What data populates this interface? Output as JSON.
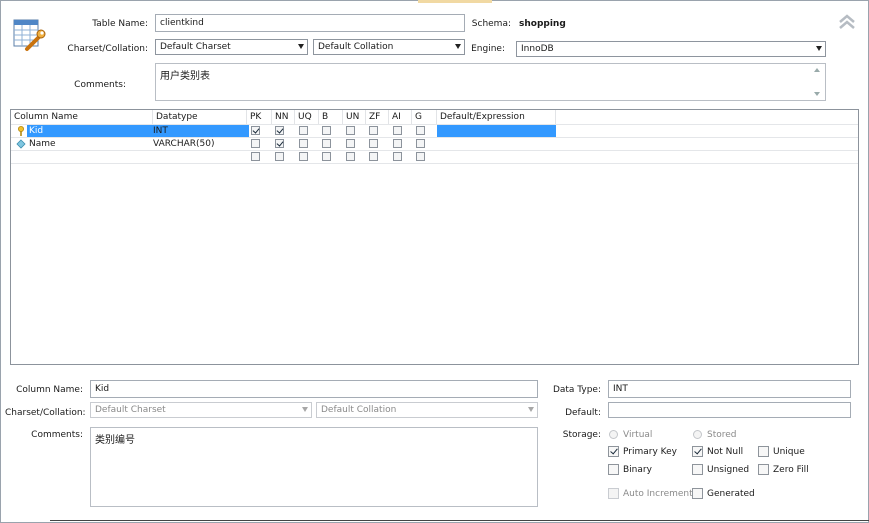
{
  "table": {
    "name_label": "Table Name:",
    "name_value": "clientkind",
    "schema_label": "Schema:",
    "schema_value": "shopping",
    "charset_label": "Charset/Collation:",
    "charset_value": "Default Charset",
    "collation_value": "Default Collation",
    "engine_label": "Engine:",
    "engine_value": "InnoDB",
    "comments_label": "Comments:",
    "comments_value": "用户类别表"
  },
  "grid": {
    "headers": [
      "Column Name",
      "Datatype",
      "PK",
      "NN",
      "UQ",
      "B",
      "UN",
      "ZF",
      "AI",
      "G",
      "Default/Expression"
    ],
    "rows": [
      {
        "name": "Kid",
        "datatype": "INT",
        "flags": [
          true,
          true,
          false,
          false,
          false,
          false,
          false,
          false
        ],
        "default": ""
      },
      {
        "name": "Name",
        "datatype": "VARCHAR(50)",
        "flags": [
          false,
          true,
          false,
          false,
          false,
          false,
          false,
          false
        ],
        "default": ""
      },
      {
        "name": "",
        "datatype": "",
        "flags": [
          false,
          false,
          false,
          false,
          false,
          false,
          false,
          false
        ],
        "default": ""
      }
    ]
  },
  "column": {
    "name_label": "Column Name:",
    "name_value": "Kid",
    "datatype_label": "Data Type:",
    "datatype_value": "INT",
    "charset_label": "Charset/Collation:",
    "charset_value": "Default Charset",
    "collation_value": "Default Collation",
    "default_label": "Default:",
    "default_value": "",
    "comments_label": "Comments:",
    "comments_value": "类别编号",
    "storage_label": "Storage:",
    "virtual_label": "Virtual",
    "stored_label": "Stored",
    "primary_key_label": "Primary Key",
    "primary_key": true,
    "not_null_label": "Not Null",
    "not_null": true,
    "unique_label": "Unique",
    "unique": false,
    "binary_label": "Binary",
    "binary": false,
    "unsigned_label": "Unsigned",
    "unsigned": false,
    "zero_fill_label": "Zero Fill",
    "zero_fill": false,
    "auto_increment_label": "Auto Increment",
    "auto_increment": false,
    "generated_label": "Generated",
    "generated": false
  },
  "colors": {
    "selection": "#3399ff",
    "default_cell": "#3399ff",
    "border": "#8c939c"
  },
  "icons": {
    "table_icon": "table-wrench-icon",
    "collapse_icon": "double-chevron-up-icon",
    "pk_icon": "key-icon",
    "column_icon": "diamond-icon"
  }
}
